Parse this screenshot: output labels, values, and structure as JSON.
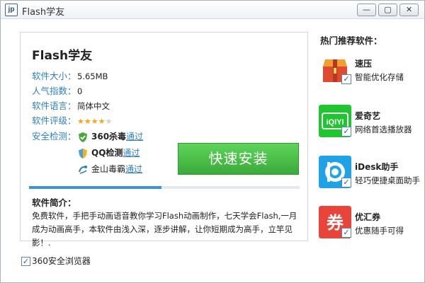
{
  "window": {
    "title": "Flash学友",
    "icon_text": "jp",
    "minimize_glyph": "—",
    "maximize_glyph": "▢",
    "close_glyph": "✕"
  },
  "software": {
    "name": "Flash学友",
    "size_label": "软件大小：",
    "size_value": "5.65MB",
    "popularity_label": "人气指数：",
    "popularity_value": "0",
    "language_label": "软件语言：",
    "language_value": "简体中文",
    "rating_label": "软件评级：",
    "rating": {
      "filled": "★★★★",
      "empty": "★",
      "value": 4,
      "max": 5
    },
    "security_label": "安全检测："
  },
  "security_checks": [
    {
      "name": "360杀毒",
      "status": "通过",
      "icon": "shield-360-icon",
      "color": "#4ca63f"
    },
    {
      "name": "QQ检测",
      "status": "通过",
      "icon": "qq-shield-icon",
      "color": "#f0b416"
    },
    {
      "name": "金山毒霸",
      "status": "通过",
      "icon": "kingsoft-icon",
      "color": "#2d7fc1"
    }
  ],
  "install_button": {
    "label": "快速安装",
    "color": "#3aaa3a"
  },
  "progress": {
    "value": 0.49
  },
  "intro": {
    "title": "软件简介：",
    "text": "免费软件，手把手动画语音教你学习Flash动画制作，七天学会Flash,一月成为动画高手，本软件由浅入深，逐步讲解，让你短期成为高手，立竿见影！."
  },
  "recommendations": {
    "title": "热门推荐软件：",
    "items": [
      {
        "name": "速压",
        "desc": "智能优化存储",
        "icon": "archive-icon",
        "color": "#e04a2f",
        "checked": true
      },
      {
        "name": "爱奇艺",
        "desc": "网络首选播放器",
        "icon": "iqiyi-icon",
        "logo_text": "iQIYI",
        "color": "#20c630",
        "checked": true
      },
      {
        "name": "iDesk助手",
        "desc": "轻巧便捷桌面助手",
        "icon": "idesk-icon",
        "color": "#1fa3e6",
        "checked": true
      },
      {
        "name": "优汇券",
        "desc": "优惠随手可得",
        "icon": "coupon-icon",
        "logo_text": "券",
        "color": "#e8443a",
        "checked": true
      }
    ]
  },
  "bottom_option": {
    "label": "360安全浏览器",
    "checked": true
  },
  "accent_color": "#2d7fc1"
}
